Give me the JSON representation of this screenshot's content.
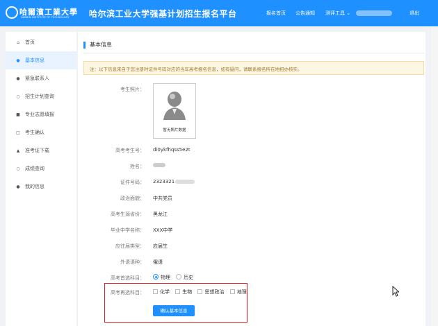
{
  "header": {
    "logo_cn": "哈爾濱工業大學",
    "logo_en": "HARBIN INSTITUTE OF TECHNOLOGY",
    "title": "哈尔滨工业大学强基计划招生报名平台",
    "nav": {
      "home": "报名首页",
      "notice": "公告通知",
      "tools": "测评工具",
      "logout": "退出"
    }
  },
  "sidebar": {
    "items": [
      {
        "label": "首页",
        "icon": "home-icon",
        "glyph": "⌂"
      },
      {
        "label": "基本信息",
        "icon": "user-icon",
        "glyph": "●"
      },
      {
        "label": "紧急联系人",
        "icon": "contact-icon",
        "glyph": "●"
      },
      {
        "label": "招生计划查询",
        "icon": "search-icon",
        "glyph": "○"
      },
      {
        "label": "专业志愿填报",
        "icon": "form-icon",
        "glyph": "■"
      },
      {
        "label": "考生确认",
        "icon": "confirm-icon",
        "glyph": "□"
      },
      {
        "label": "准考证下载",
        "icon": "download-icon",
        "glyph": "▲"
      },
      {
        "label": "成绩查询",
        "icon": "score-search-icon",
        "glyph": "○"
      },
      {
        "label": "我的信息",
        "icon": "bell-icon",
        "glyph": "●"
      }
    ],
    "active_index": 1
  },
  "main": {
    "section_title": "基本信息",
    "notice": "注：以下信息来自于您注册时证件号码对应的当年高考报名信息，如有疑问，请联系报名所在地招办核实。",
    "photo_label": "考生照片：",
    "photo_caption": "暂无照片数据",
    "fields": {
      "exam_no": {
        "label": "高考考生号：",
        "value": "di0ykfhqss5e2t"
      },
      "name": {
        "label": "姓名："
      },
      "id_no": {
        "label": "证件号码：",
        "value": "2323321"
      },
      "political": {
        "label": "政治面貌：",
        "value": "中共党员"
      },
      "province": {
        "label": "高考生源省份：",
        "value": "黑龙江"
      },
      "school": {
        "label": "毕业中学名称：",
        "value": "XXX中学"
      },
      "category": {
        "label": "应往届类型：",
        "value": "应届生"
      },
      "language": {
        "label": "外语语种：",
        "value": "俄语"
      }
    },
    "first_subject": {
      "label": "高考首选科目：",
      "options": [
        "物理",
        "历史"
      ],
      "selected": "物理"
    },
    "second_subject": {
      "label": "高考再选科目：",
      "options": [
        "化学",
        "生物",
        "思想政治",
        "地理"
      ]
    },
    "confirm_button": "确认基本信息"
  },
  "colors": {
    "brand": "#1e90ff",
    "highlight": "#e02020",
    "notice_bg": "#fdf6e3"
  }
}
